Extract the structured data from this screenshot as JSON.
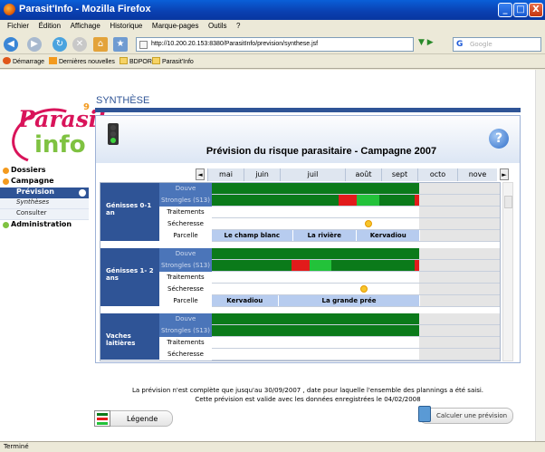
{
  "window": {
    "title": "Parasit'Info - Mozilla Firefox",
    "minimize": "_",
    "maximize": "□",
    "close": "X"
  },
  "menu": [
    "Fichier",
    "Édition",
    "Affichage",
    "Historique",
    "Marque-pages",
    "Outils",
    "?"
  ],
  "nav": {
    "url": "http://10.200.20.153:8380/ParasitInfo/prevision/synthese.jsf",
    "search_placeholder": "Google",
    "search_engine": "G"
  },
  "bookmarks": [
    "Démarrage",
    "Dernières nouvelles",
    "BDPORC",
    "Parasit'Info"
  ],
  "logo": {
    "top": "Parasit",
    "bottom": "info",
    "mark": "9"
  },
  "sidebar": {
    "items": [
      {
        "label": "Dossiers",
        "color": "#f39a1e"
      },
      {
        "label": "Campagne",
        "color": "#f39a1e"
      }
    ],
    "active": "Prévision",
    "subitems": [
      "Synthèses",
      "Consulter"
    ],
    "last": {
      "label": "Administration",
      "color": "#7fc241"
    }
  },
  "page": {
    "section": "SYNTHÈSE",
    "panel_title": "Prévision du risque parasitaire - Campagne 2007",
    "help": "?",
    "months": [
      "mai",
      "juin",
      "juil",
      "août",
      "sept",
      "octo",
      "nove"
    ],
    "scroll_left": "◄",
    "scroll_right": "►"
  },
  "groups": [
    {
      "name": "Génisses 0-1 an",
      "rows": [
        {
          "label": "Douve",
          "type": "timeline",
          "segments": [
            {
              "from": 0,
              "to": 0.716,
              "color": "#0b7a1a"
            }
          ]
        },
        {
          "label": "Strongles (S13)",
          "type": "timeline",
          "segments": [
            {
              "from": 0,
              "to": 0.438,
              "color": "#0b7a1a"
            },
            {
              "from": 0.438,
              "to": 0.5,
              "color": "#e21b1b"
            },
            {
              "from": 0.5,
              "to": 0.578,
              "color": "#23c23a"
            },
            {
              "from": 0.578,
              "to": 0.7,
              "color": "#0b7a1a"
            },
            {
              "from": 0.7,
              "to": 0.716,
              "color": "#e21b1b"
            }
          ]
        },
        {
          "label": "Traitements",
          "type": "timeline",
          "segments": []
        },
        {
          "label": "Sécheresse",
          "type": "sun",
          "sun_at": 0.528
        },
        {
          "label": "Parcelle",
          "type": "parcel",
          "parcels": [
            {
              "name": "Le champ blanc",
              "from": 0,
              "to": 0.28
            },
            {
              "name": "La rivière",
              "from": 0.28,
              "to": 0.5
            },
            {
              "name": "Kervadiou",
              "from": 0.5,
              "to": 0.72
            }
          ]
        }
      ]
    },
    {
      "name": "Génisses 1- 2 ans",
      "rows": [
        {
          "label": "Douve",
          "type": "timeline",
          "segments": [
            {
              "from": 0,
              "to": 0.716,
              "color": "#0b7a1a"
            }
          ]
        },
        {
          "label": "Strongles (S13)",
          "type": "timeline",
          "segments": [
            {
              "from": 0,
              "to": 0.275,
              "color": "#0b7a1a"
            },
            {
              "from": 0.275,
              "to": 0.338,
              "color": "#e21b1b"
            },
            {
              "from": 0.338,
              "to": 0.413,
              "color": "#23c23a"
            },
            {
              "from": 0.413,
              "to": 0.7,
              "color": "#0b7a1a"
            },
            {
              "from": 0.7,
              "to": 0.716,
              "color": "#e21b1b"
            }
          ]
        },
        {
          "label": "Traitements",
          "type": "timeline",
          "segments": []
        },
        {
          "label": "Sécheresse",
          "type": "sun",
          "sun_at": 0.513
        },
        {
          "label": "Parcelle",
          "type": "parcel",
          "parcels": [
            {
              "name": "Kervadiou",
              "from": 0,
              "to": 0.23
            },
            {
              "name": "La grande prée",
              "from": 0.23,
              "to": 0.72
            }
          ]
        }
      ]
    },
    {
      "name": "Vaches laitières",
      "rows": [
        {
          "label": "Douve",
          "type": "timeline",
          "segments": [
            {
              "from": 0,
              "to": 0.716,
              "color": "#0b7a1a"
            }
          ]
        },
        {
          "label": "Strongles (S13)",
          "type": "timeline",
          "segments": [
            {
              "from": 0,
              "to": 0.716,
              "color": "#0b7a1a"
            }
          ]
        },
        {
          "label": "Traitements",
          "type": "timeline",
          "segments": []
        },
        {
          "label": "Sécheresse",
          "type": "timeline",
          "segments": []
        }
      ]
    }
  ],
  "footer": {
    "note_line1": "La prévision n'est complète que jusqu'au 30/09/2007 , date pour laquelle l'ensemble des plannings a été saisi.",
    "note_line2": "Cette prévision est valide avec les données enregistrées le 04/02/2008",
    "legend_button": "Légende",
    "calc_button": "Calculer une prévision"
  },
  "status": "Terminé"
}
